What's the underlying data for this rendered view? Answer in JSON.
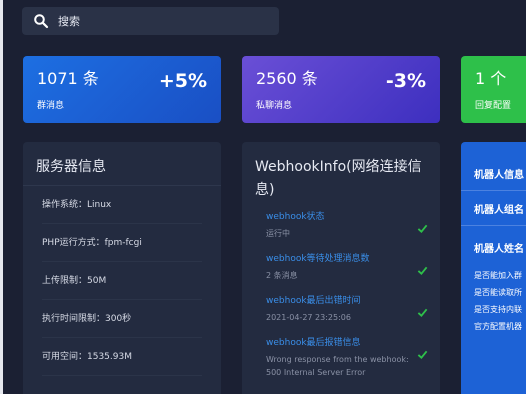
{
  "search": {
    "placeholder": "搜索"
  },
  "stats": [
    {
      "count": "1071 条",
      "label": "群消息",
      "change": "+5%"
    },
    {
      "count": "2560 条",
      "label": "私聊消息",
      "change": "-3%"
    },
    {
      "count": "1 个",
      "label": "回复配置"
    }
  ],
  "server": {
    "title": "服务器信息",
    "rows": [
      "操作系统：Linux",
      "PHP运行方式：fpm-fcgi",
      "上传限制：50M",
      "执行时间限制：300秒",
      "可用空间：1535.93M"
    ]
  },
  "webhook": {
    "title": "WebhookInfo(网络连接信息)",
    "items": [
      {
        "key": "webhook状态",
        "value": "运行中"
      },
      {
        "key": "webhook等待处理消息数",
        "value": "2 条消息"
      },
      {
        "key": "webhook最后出错时间",
        "value": "2021-04-27 23:25:06"
      },
      {
        "key": "webhook最后报错信息",
        "value": "Wrong response from the webhook:",
        "value2": "500 Internal Server Error"
      }
    ]
  },
  "robot": {
    "heading1": "机器人信息",
    "heading2": "机器人组名",
    "heading3": "机器人姓名",
    "lines": [
      "是否能加入群",
      "是否能读取所",
      "是否支持内联",
      "官方配置机器"
    ]
  },
  "colors": {
    "background": "#1b2033",
    "panel": "#232b40",
    "link": "#3a8ee8",
    "check": "#2ec04a"
  }
}
